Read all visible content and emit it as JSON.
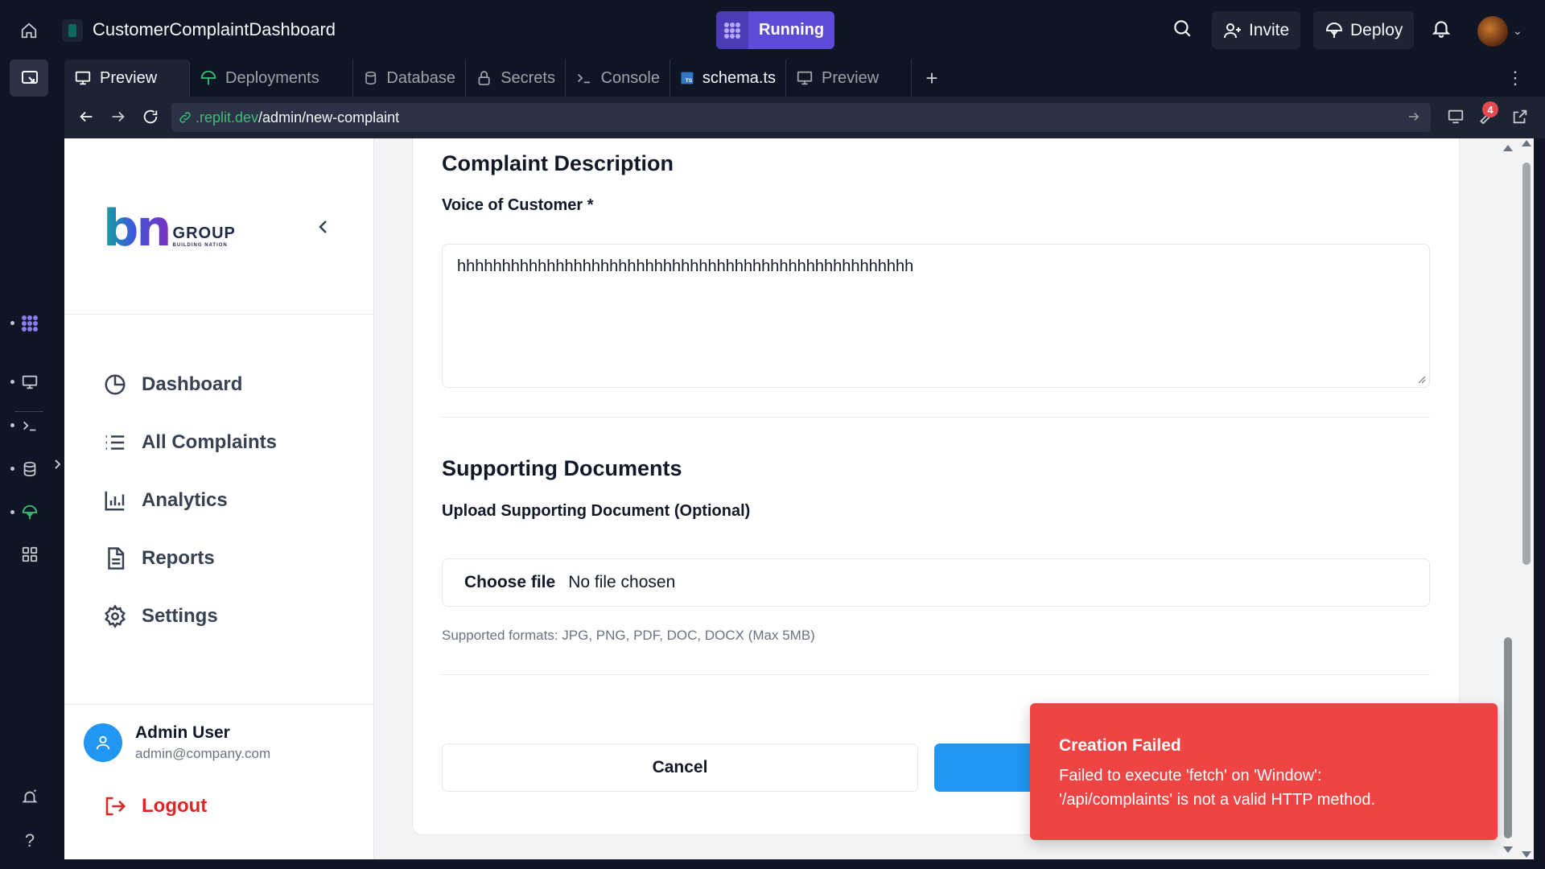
{
  "topbar": {
    "repl_name": "CustomerComplaintDashboard",
    "run_label": "Running",
    "invite_label": "Invite",
    "deploy_label": "Deploy"
  },
  "tabs": [
    {
      "label": "Preview"
    },
    {
      "label": "Deployments"
    },
    {
      "label": "Database"
    },
    {
      "label": "Secrets"
    },
    {
      "label": "Console"
    },
    {
      "label": "schema.ts"
    },
    {
      "label": "Preview"
    }
  ],
  "urlbar": {
    "host": ".replit.dev",
    "path": "/admin/new-complaint",
    "badge_count": "4"
  },
  "app": {
    "logo_text": "bn",
    "logo_group": "GROUP",
    "logo_tagline": "BUILDING NATION",
    "nav": [
      {
        "label": "Dashboard",
        "icon": "pie-chart-icon"
      },
      {
        "label": "All Complaints",
        "icon": "list-icon"
      },
      {
        "label": "Analytics",
        "icon": "bar-chart-icon"
      },
      {
        "label": "Reports",
        "icon": "document-icon"
      },
      {
        "label": "Settings",
        "icon": "gear-icon"
      }
    ],
    "user": {
      "name": "Admin User",
      "email": "admin@company.com"
    },
    "logout_label": "Logout"
  },
  "form": {
    "description_title": "Complaint Description",
    "voc_label": "Voice of Customer *",
    "voc_value": "hhhhhhhhhhhhhhhhhhhhhhhhhhhhhhhhhhhhhhhhhhhhhhhhhhh",
    "docs_title": "Supporting Documents",
    "upload_label": "Upload Supporting Document (Optional)",
    "file_button": "Choose file",
    "file_status": "No file chosen",
    "hint": "Supported formats: JPG, PNG, PDF, DOC, DOCX (Max 5MB)",
    "cancel_label": "Cancel"
  },
  "toast": {
    "title": "Creation Failed",
    "message_line1": "Failed to execute 'fetch' on 'Window':",
    "message_line2": "'/api/complaints' is not a valid HTTP method."
  },
  "colors": {
    "ide_bg": "#0e1525",
    "run_purple": "#5d4ad6",
    "primary_blue": "#2196f3",
    "error_red": "#ef4444",
    "url_green": "#3cbe76"
  }
}
